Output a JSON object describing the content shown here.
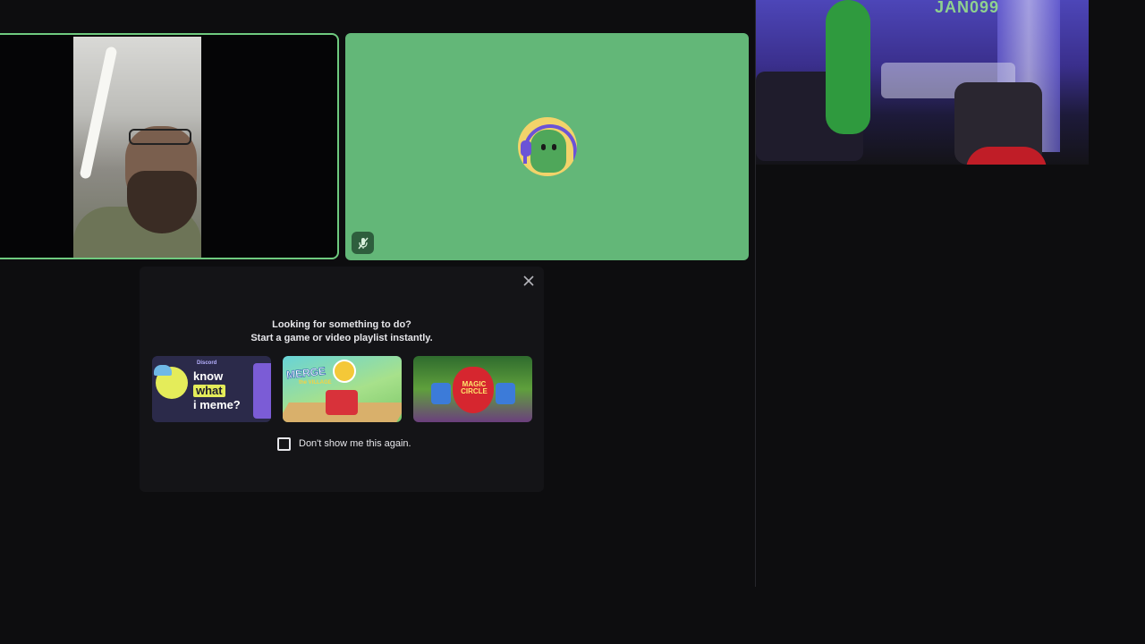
{
  "stream": {
    "name_overlay": "JAN099"
  },
  "popup": {
    "line1": "Looking for something to do?",
    "line2": "Start a game or video playlist instantly.",
    "activities": [
      {
        "id": "know-what-i-meme",
        "lines": [
          "know",
          "what",
          "i meme?"
        ],
        "brand": "Discord"
      },
      {
        "id": "merge-the-village",
        "logo": "MERGE",
        "sub": "the VILLAGE"
      },
      {
        "id": "magic-circle",
        "title": "MAGIC CIRCLE"
      }
    ],
    "dont_show_label": "Don't show me this again."
  },
  "icons": {
    "close": "close-icon",
    "muted": "microphone-muted-icon"
  },
  "colors": {
    "background": "#0d0d0f",
    "speaking_border": "#6fca7f",
    "avatar_tile": "#63b778",
    "popup_bg": "#141417"
  }
}
